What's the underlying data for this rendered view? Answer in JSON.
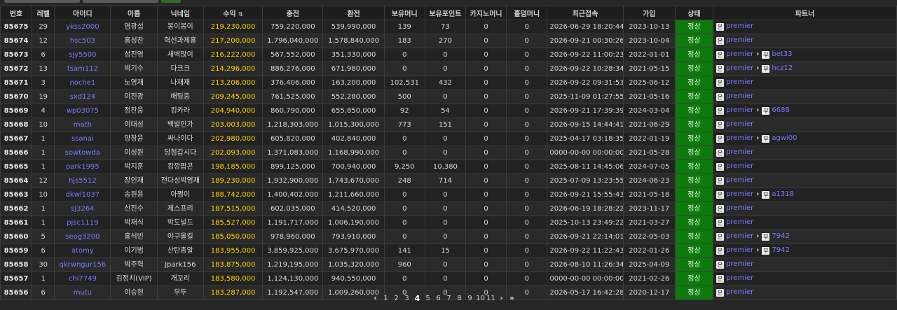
{
  "columns": [
    "번호",
    "레벨",
    "아이디",
    "이름",
    "닉네임",
    "수익",
    "충전",
    "환전",
    "보유머니",
    "보유포인트",
    "카지노머니",
    "홀덤머니",
    "최근접속",
    "가입",
    "상태",
    "파트너"
  ],
  "sort_indicator": "⇅",
  "partner_badge_top": "본",
  "partner_badge_sub": "부",
  "partner_arrow": "›",
  "rows": [
    {
      "no": "85675",
      "level": "29",
      "id": "ykss2000",
      "name": "염광섭",
      "nick": "봉이봉이",
      "profit": "219,230,000",
      "deposit": "759,220,000",
      "withdraw": "539,990,000",
      "money": "139",
      "point": "73",
      "casino": "0",
      "holdem": "0",
      "last": "2026-06-29 18:20:44",
      "join": "2023-10-13",
      "status": "정상",
      "partner": "premier",
      "sub": ""
    },
    {
      "no": "85674",
      "level": "12",
      "id": "hsc503",
      "name": "홍성찬",
      "nick": "혁선과제홍",
      "profit": "217,200,000",
      "deposit": "1,796,040,000",
      "withdraw": "1,578,840,000",
      "money": "183",
      "point": "270",
      "casino": "0",
      "holdem": "0",
      "last": "2026-09-21 00:30:26",
      "join": "2023-10-04",
      "status": "정상",
      "partner": "premier",
      "sub": ""
    },
    {
      "no": "85673",
      "level": "6",
      "id": "sjy5500",
      "name": "성진영",
      "nick": "새벽많이",
      "profit": "216,222,000",
      "deposit": "567,552,000",
      "withdraw": "351,330,000",
      "money": "0",
      "point": "0",
      "casino": "0",
      "holdem": "0",
      "last": "2026-09-22 11:00:23",
      "join": "2022-01-01",
      "status": "정상",
      "partner": "premier",
      "sub": "bet33"
    },
    {
      "no": "85672",
      "level": "13",
      "id": "tsam112",
      "name": "박기수",
      "nick": "다크크",
      "profit": "214,296,000",
      "deposit": "886,276,000",
      "withdraw": "671,980,000",
      "money": "0",
      "point": "0",
      "casino": "0",
      "holdem": "0",
      "last": "2026-09-22 10:28:34",
      "join": "2021-05-15",
      "status": "정상",
      "partner": "premier",
      "sub": "hcz12"
    },
    {
      "no": "85671",
      "level": "3",
      "id": "noche1",
      "name": "노영재",
      "nick": "나재재",
      "profit": "213,206,000",
      "deposit": "376,406,000",
      "withdraw": "163,200,000",
      "money": "102,531",
      "point": "432",
      "casino": "0",
      "holdem": "0",
      "last": "2026-09-22 09:31:53",
      "join": "2025-06-12",
      "status": "정상",
      "partner": "premier",
      "sub": ""
    },
    {
      "no": "85670",
      "level": "19",
      "id": "sxd124",
      "name": "이진광",
      "nick": "배팅중",
      "profit": "209,245,000",
      "deposit": "761,525,000",
      "withdraw": "552,280,000",
      "money": "500",
      "point": "0",
      "casino": "0",
      "holdem": "0",
      "last": "2025-11-09 01:27:55",
      "join": "2021-05-16",
      "status": "정상",
      "partner": "premier",
      "sub": ""
    },
    {
      "no": "85669",
      "level": "4",
      "id": "wp03075",
      "name": "정찬웅",
      "nick": "킹카라",
      "profit": "204,940,000",
      "deposit": "860,790,000",
      "withdraw": "655,850,000",
      "money": "92",
      "point": "54",
      "casino": "0",
      "holdem": "0",
      "last": "2026-09-21 17:39:39",
      "join": "2024-03-04",
      "status": "정상",
      "partner": "premier",
      "sub": "6688"
    },
    {
      "no": "85668",
      "level": "10",
      "id": "math",
      "name": "이대성",
      "nick": "백발인가",
      "profit": "203,003,000",
      "deposit": "1,218,303,000",
      "withdraw": "1,015,300,000",
      "money": "773",
      "point": "151",
      "casino": "0",
      "holdem": "0",
      "last": "2026-09-15 14:44:41",
      "join": "2021-06-29",
      "status": "정상",
      "partner": "premier",
      "sub": ""
    },
    {
      "no": "85667",
      "level": "1",
      "id": "ssanai",
      "name": "양창윤",
      "nick": "싸나이다",
      "profit": "202,980,000",
      "deposit": "605,820,000",
      "withdraw": "402,840,000",
      "money": "0",
      "point": "0",
      "casino": "0",
      "holdem": "0",
      "last": "2025-04-17 03:18:35",
      "join": "2022-01-19",
      "status": "정상",
      "partner": "premier",
      "sub": "agwi00"
    },
    {
      "no": "85666",
      "level": "1",
      "id": "sowtowda",
      "name": "이성원",
      "nick": "당첨갑시다",
      "profit": "202,093,000",
      "deposit": "1,371,083,000",
      "withdraw": "1,168,990,000",
      "money": "0",
      "point": "0",
      "casino": "0",
      "holdem": "0",
      "last": "0000-00-00 00:00:00",
      "join": "2021-05-28",
      "status": "정상",
      "partner": "premier",
      "sub": ""
    },
    {
      "no": "85665",
      "level": "1",
      "id": "park1995",
      "name": "박지훈",
      "nick": "킹깡팝콘",
      "profit": "198,185,000",
      "deposit": "899,125,000",
      "withdraw": "700,940,000",
      "money": "9,250",
      "point": "10,380",
      "casino": "0",
      "holdem": "0",
      "last": "2025-08-11 14:45:06",
      "join": "2024-07-05",
      "status": "정상",
      "partner": "premier",
      "sub": ""
    },
    {
      "no": "85664",
      "level": "12",
      "id": "hjs5512",
      "name": "장인재",
      "nick": "전다성박영재",
      "profit": "189,230,000",
      "deposit": "1,932,900,000",
      "withdraw": "1,743,670,000",
      "money": "248",
      "point": "714",
      "casino": "0",
      "holdem": "0",
      "last": "2025-07-09 13:23:55",
      "join": "2024-06-23",
      "status": "정상",
      "partner": "premier",
      "sub": ""
    },
    {
      "no": "85663",
      "level": "10",
      "id": "dkwl1037",
      "name": "송원용",
      "nick": "아쩡이",
      "profit": "188,742,000",
      "deposit": "1,400,402,000",
      "withdraw": "1,211,660,000",
      "money": "0",
      "point": "0",
      "casino": "0",
      "holdem": "0",
      "last": "2026-09-21 15:55:43",
      "join": "2021-05-18",
      "status": "정상",
      "partner": "premier",
      "sub": "a1318"
    },
    {
      "no": "85662",
      "level": "1",
      "id": "sj3264",
      "name": "신진수",
      "nick": "제스프리",
      "profit": "187,515,000",
      "deposit": "602,035,000",
      "withdraw": "414,520,000",
      "money": "0",
      "point": "0",
      "casino": "0",
      "holdem": "0",
      "last": "2026-06-19 18:28:22",
      "join": "2023-11-17",
      "status": "정상",
      "partner": "premier",
      "sub": ""
    },
    {
      "no": "85661",
      "level": "1",
      "id": "pjsc1119",
      "name": "박재식",
      "nick": "박도널드",
      "profit": "185,527,000",
      "deposit": "1,191,717,000",
      "withdraw": "1,006,190,000",
      "money": "0",
      "point": "0",
      "casino": "0",
      "holdem": "0",
      "last": "2025-10-13 23:49:22",
      "join": "2021-03-27",
      "status": "정상",
      "partner": "premier",
      "sub": ""
    },
    {
      "no": "85660",
      "level": "5",
      "id": "seog3200",
      "name": "홍석빈",
      "nick": "야구올킬",
      "profit": "185,050,000",
      "deposit": "978,960,000",
      "withdraw": "793,910,000",
      "money": "0",
      "point": "0",
      "casino": "0",
      "holdem": "0",
      "last": "2026-09-21 22:14:01",
      "join": "2022-05-03",
      "status": "정상",
      "partner": "premier",
      "sub": "7942"
    },
    {
      "no": "85659",
      "level": "6",
      "id": "atomy",
      "name": "이기범",
      "nick": "산탄총알",
      "profit": "183,955,000",
      "deposit": "3,859,925,000",
      "withdraw": "3,675,970,000",
      "money": "141",
      "point": "15",
      "casino": "0",
      "holdem": "0",
      "last": "2026-09-22 11:22:43",
      "join": "2022-01-26",
      "status": "정상",
      "partner": "premier",
      "sub": "7942"
    },
    {
      "no": "85658",
      "level": "30",
      "id": "qkrwngur156",
      "name": "박주혁",
      "nick": "Jpark156",
      "profit": "183,875,000",
      "deposit": "1,219,195,000",
      "withdraw": "1,035,320,000",
      "money": "960",
      "point": "0",
      "casino": "0",
      "holdem": "0",
      "last": "2026-08-10 11:26:34",
      "join": "2025-04-09",
      "status": "정상",
      "partner": "premier",
      "sub": ""
    },
    {
      "no": "85657",
      "level": "1",
      "id": "chi7749",
      "name": "김정치(VIP)",
      "nick": "개꼬리",
      "profit": "183,580,000",
      "deposit": "1,124,130,000",
      "withdraw": "940,550,000",
      "money": "0",
      "point": "0",
      "casino": "0",
      "holdem": "0",
      "last": "0000-00-00 00:00:00",
      "join": "2021-02-26",
      "status": "정상",
      "partner": "premier",
      "sub": ""
    },
    {
      "no": "85656",
      "level": "6",
      "id": "mutu",
      "name": "이승현",
      "nick": "무뚜",
      "profit": "183,287,000",
      "deposit": "1,192,547,000",
      "withdraw": "1,009,260,000",
      "money": "0",
      "point": "0",
      "casino": "0",
      "holdem": "0",
      "last": "2026-05-17 16:42:28",
      "join": "2020-12-17",
      "status": "정상",
      "partner": "premier",
      "sub": ""
    }
  ],
  "pagination": {
    "prev": "‹",
    "next": "›",
    "last": "»",
    "pages": [
      "1",
      "2",
      "3",
      "4",
      "5",
      "6",
      "7",
      "8",
      "9",
      "10",
      "11"
    ],
    "current": "4"
  },
  "colors": {
    "status_bg": "#0e7a0e",
    "profit": "#ffd400",
    "link": "#7b7bff"
  }
}
